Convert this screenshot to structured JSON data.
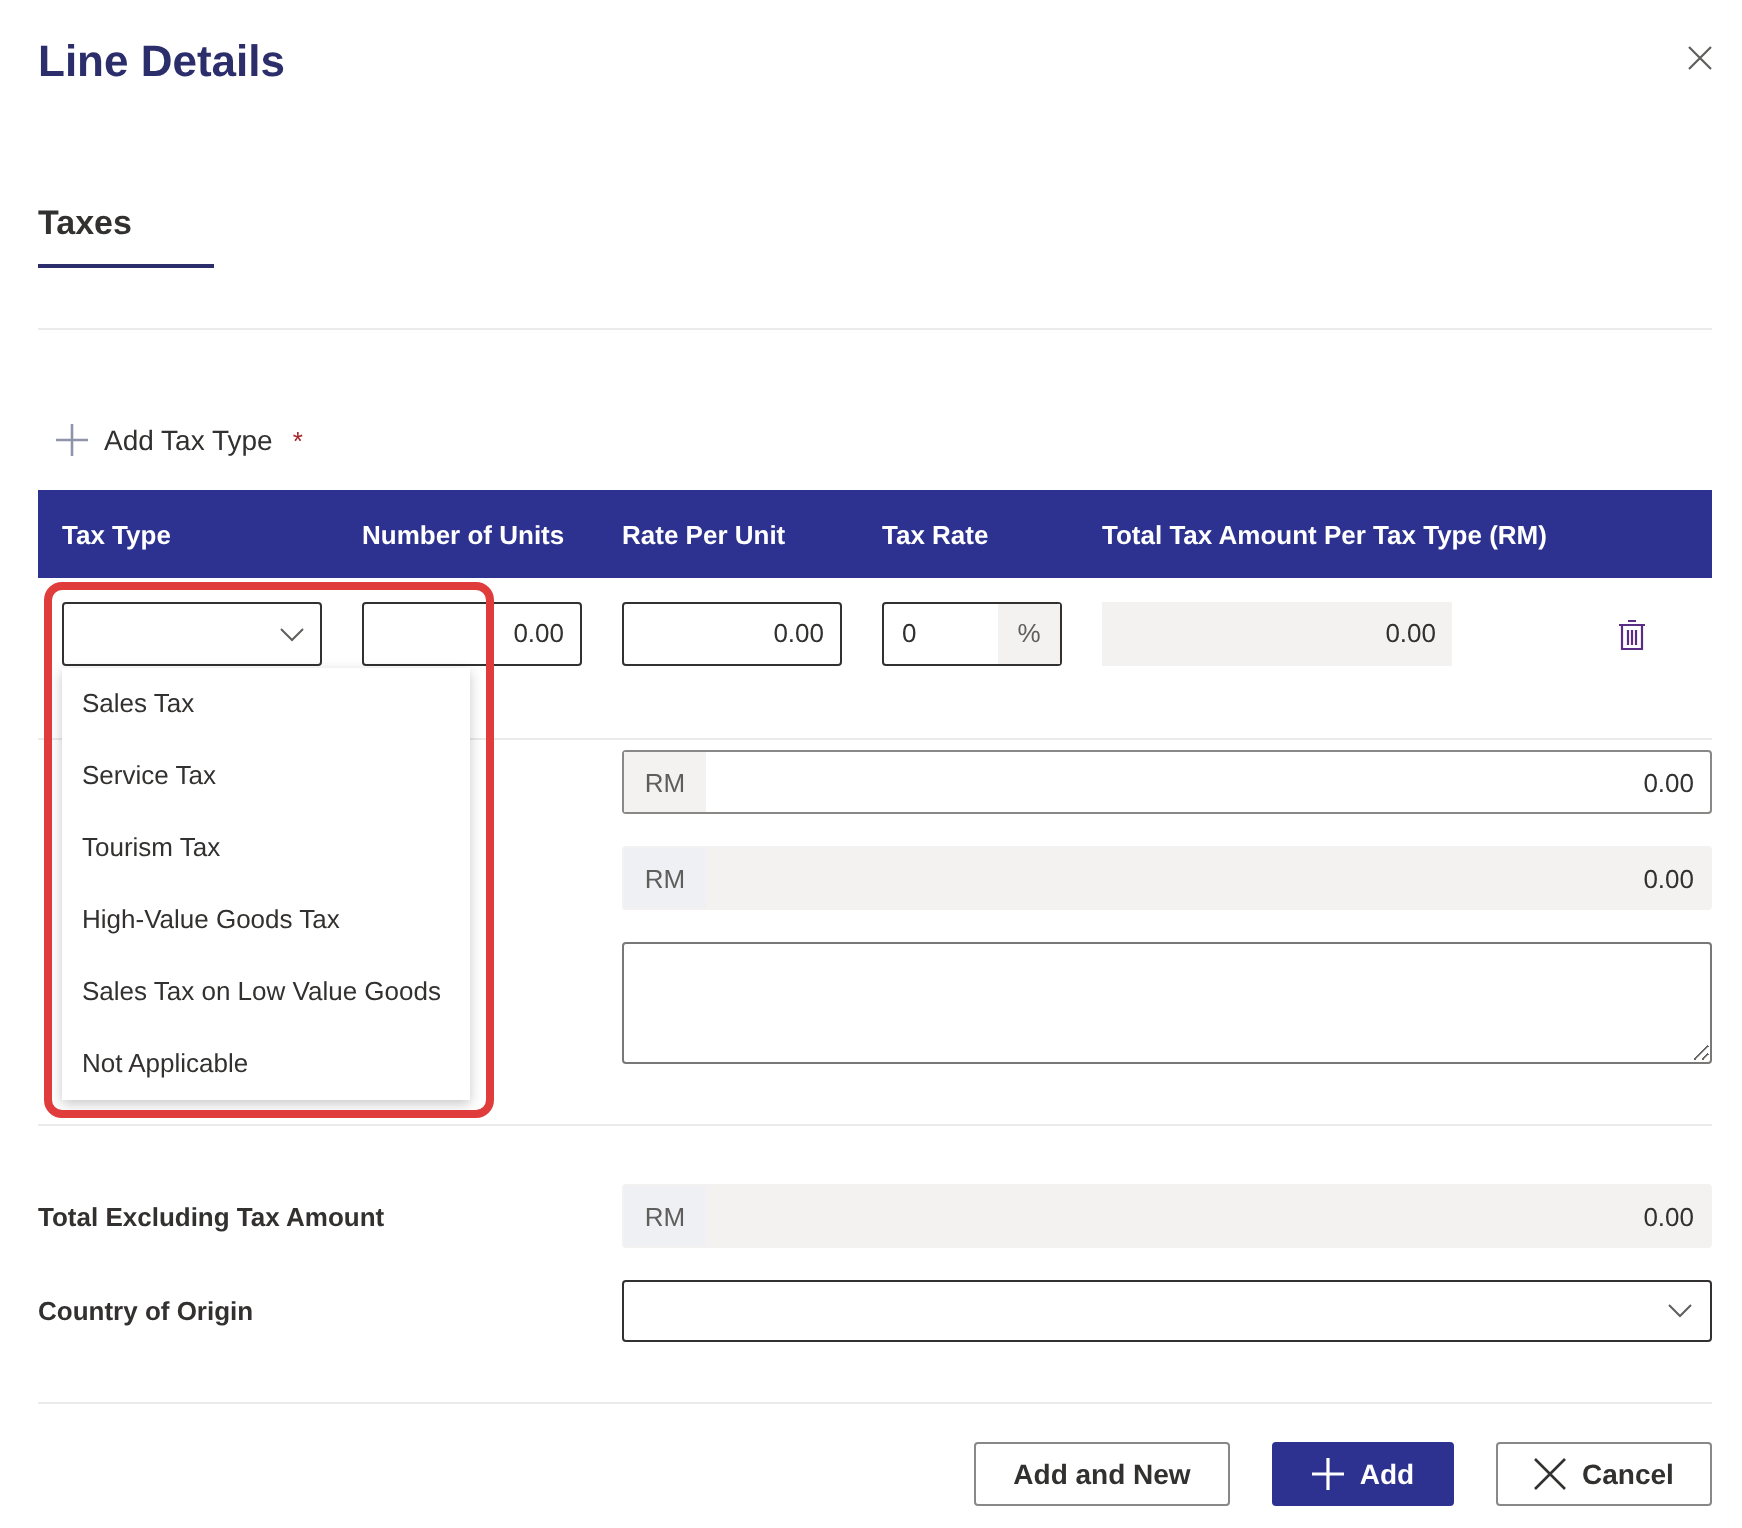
{
  "dialog": {
    "title": "Line Details"
  },
  "tabs": [
    {
      "label": "Taxes",
      "selected": true
    }
  ],
  "add_tax_type": {
    "label": "Add Tax Type",
    "required_mark": "*"
  },
  "tax_table": {
    "columns": [
      "Tax Type",
      "Number of Units",
      "Rate Per Unit",
      "Tax Rate",
      "Total Tax Amount Per Tax Type (RM)"
    ],
    "rows": [
      {
        "tax_type_dropdown": {
          "expanded": true,
          "options": [
            {
              "label": "Sales Tax",
              "selected": false
            },
            {
              "label": "Service Tax",
              "selected": false
            },
            {
              "label": "Tourism Tax",
              "selected": false
            },
            {
              "label": "High-Value Goods Tax",
              "selected": false
            },
            {
              "label": "Sales Tax on Low Value Goods",
              "selected": false
            },
            {
              "label": "Not Applicable",
              "selected": false
            }
          ]
        },
        "number_of_units": "0.00",
        "rate_per_unit": "0.00",
        "tax_rate": "0",
        "tax_rate_suffix": "%",
        "total_tax_amount": "0.00"
      }
    ]
  },
  "annotation": {
    "kind": "highlight"
  },
  "upper_fields": [
    {
      "kind": "amount",
      "prefix": "RM",
      "value": "0.00",
      "readonly": false
    },
    {
      "kind": "amount",
      "prefix": "RM",
      "value": "0.00",
      "readonly": true
    },
    {
      "kind": "textarea"
    }
  ],
  "lower_fields": [
    {
      "kind": "amount",
      "label": "Total Excluding Tax Amount",
      "prefix": "RM",
      "value": "0.00",
      "readonly": true
    },
    {
      "kind": "select",
      "label": "Country of Origin"
    }
  ],
  "buttons": [
    {
      "kind": "secondary",
      "label": "Add and New"
    },
    {
      "kind": "primary",
      "label": "Add"
    },
    {
      "kind": "cancel",
      "label": "Cancel"
    }
  ]
}
